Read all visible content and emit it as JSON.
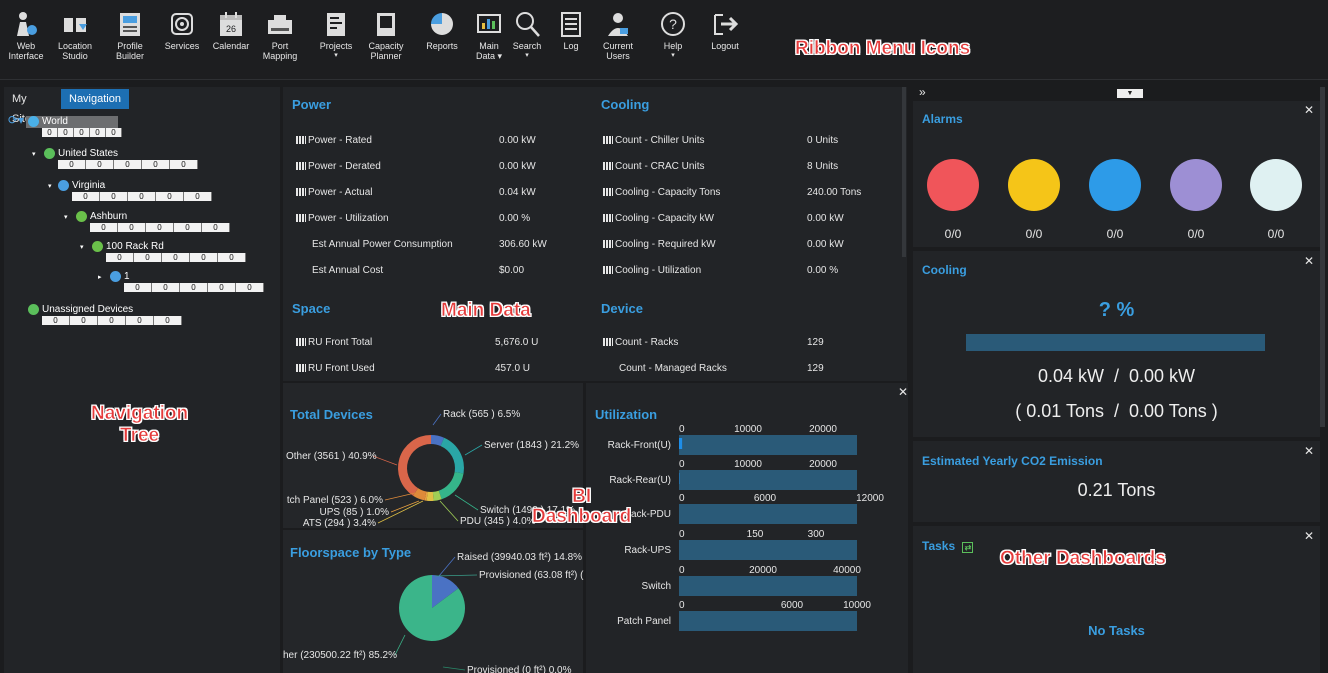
{
  "ribbon": {
    "items": [
      {
        "label": "Web\nInterface",
        "icon": "web-interface-icon"
      },
      {
        "label": "Location\nStudio",
        "icon": "location-studio-icon"
      },
      {
        "label": "Profile\nBuilder",
        "icon": "profile-builder-icon"
      },
      {
        "label": "Services",
        "icon": "services-icon"
      },
      {
        "label": "Calendar",
        "icon": "calendar-icon",
        "badge": "26"
      },
      {
        "label": "Port\nMapping",
        "icon": "port-mapping-icon"
      },
      {
        "label": "Projects",
        "icon": "projects-icon",
        "dropdown": true
      },
      {
        "label": "Capacity\nPlanner",
        "icon": "capacity-planner-icon"
      },
      {
        "label": "Reports",
        "icon": "reports-icon"
      },
      {
        "label": "Main\nData ▾",
        "icon": "main-data-icon"
      },
      {
        "label": "Search",
        "icon": "search-icon",
        "dropdown": true
      },
      {
        "label": "Log",
        "icon": "log-icon"
      },
      {
        "label": "Current\nUsers",
        "icon": "current-users-icon"
      },
      {
        "label": "Help",
        "icon": "help-icon",
        "dropdown": true
      },
      {
        "label": "Logout",
        "icon": "logout-icon"
      }
    ],
    "annotation": "Ribbon Menu Icons"
  },
  "nav": {
    "tabs": [
      "My Sites",
      "Navigation"
    ],
    "annotation": "Navigation\nTree",
    "tree": [
      {
        "label": "World",
        "counts": [
          "0",
          "0",
          "0",
          "0",
          "0"
        ]
      },
      {
        "label": "United States",
        "counts": [
          "0",
          "0",
          "0",
          "0",
          "0"
        ]
      },
      {
        "label": "Virginia",
        "counts": [
          "0",
          "0",
          "0",
          "0",
          "0"
        ]
      },
      {
        "label": "Ashburn",
        "counts": [
          "0",
          "0",
          "0",
          "0",
          "0"
        ]
      },
      {
        "label": "100 Rack Rd",
        "counts": [
          "0",
          "0",
          "0",
          "0",
          "0"
        ]
      },
      {
        "label": "1",
        "counts": [
          "0",
          "0",
          "0",
          "0",
          "0"
        ]
      },
      {
        "label": "Unassigned Devices",
        "counts": [
          "0",
          "0",
          "0",
          "0",
          "0"
        ]
      }
    ]
  },
  "main": {
    "annotation": "Main Data",
    "power": {
      "title": "Power",
      "rows": [
        {
          "label": "Power - Rated",
          "value": "0.00 kW",
          "chart": true
        },
        {
          "label": "Power - Derated",
          "value": "0.00 kW",
          "chart": true
        },
        {
          "label": "Power - Actual",
          "value": "0.04 kW",
          "chart": true
        },
        {
          "label": "Power - Utilization",
          "value": "0.00 %",
          "chart": true
        },
        {
          "label": "Est Annual Power Consumption",
          "value": "306.60 kW",
          "chart": false
        },
        {
          "label": "Est Annual Cost",
          "value": "$0.00",
          "chart": false
        }
      ]
    },
    "cooling": {
      "title": "Cooling",
      "rows": [
        {
          "label": "Count - Chiller Units",
          "value": "0   Units"
        },
        {
          "label": "Count - CRAC Units",
          "value": "8   Units"
        },
        {
          "label": "Cooling - Capacity Tons",
          "value": "240.00 Tons"
        },
        {
          "label": "Cooling - Capacity kW",
          "value": "0.00 kW"
        },
        {
          "label": "Cooling - Required kW",
          "value": "0.00 kW"
        },
        {
          "label": "Cooling - Utilization",
          "value": "0.00 %"
        }
      ]
    },
    "space": {
      "title": "Space",
      "rows": [
        {
          "label": "RU Front Total",
          "value": "5,676.0  U",
          "chart": true
        },
        {
          "label": "RU Front Used",
          "value": "457.0  U",
          "chart": true
        }
      ]
    },
    "device": {
      "title": "Device",
      "rows": [
        {
          "label": "Count - Racks",
          "value": "129",
          "chart": true
        },
        {
          "label": "Count - Managed Racks",
          "value": "129",
          "chart": false
        }
      ]
    }
  },
  "bi": {
    "annotation_line1": "BI",
    "annotation_line2": "Dashboard",
    "total_devices": {
      "title": "Total Devices",
      "slices": [
        {
          "label": "Rack  (565 ) 6.5%",
          "value": 6.5,
          "color": "#4a72c4"
        },
        {
          "label": "Server  (1843 ) 21.2%",
          "value": 21.2,
          "color": "#2aa6a6"
        },
        {
          "label": "Switch  (1492 ) 17.1%",
          "value": 17.1,
          "color": "#35b58a"
        },
        {
          "label": "PDU  (345 ) 4.0%",
          "value": 4.0,
          "color": "#9fcf56"
        },
        {
          "label": "ATS  (294 ) 3.4%",
          "value": 3.4,
          "color": "#e0c045"
        },
        {
          "label": "UPS  (85 ) 1.0%",
          "value": 1.0,
          "color": "#e8a040"
        },
        {
          "label": "tch Panel  (523 ) 6.0%",
          "value": 6.0,
          "color": "#de8a3a"
        },
        {
          "label": "Other  (3561 ) 40.9%",
          "value": 40.9,
          "color": "#d9664a"
        }
      ]
    },
    "floorspace": {
      "title": "Floorspace by Type",
      "slices": [
        {
          "label": "Raised  (39940.03 ft²) 14.8%",
          "value": 14.8,
          "color": "#4a72c4"
        },
        {
          "label": "Provisioned  (63.08 ft²) (",
          "value": 0.02,
          "color": "#3a9e8a"
        },
        {
          "label": "her  (230500.22 ft²) 85.2%",
          "value": 85.2,
          "color": "#3bb58a"
        },
        {
          "label": "Provisioned  (0 ft²) 0.0%",
          "value": 0.0,
          "color": "#2a8a6a"
        }
      ]
    },
    "utilization": {
      "title": "Utilization",
      "rows": [
        {
          "label": "Rack-Front(U)",
          "ticks": [
            "0",
            "10000",
            "20000"
          ],
          "value": 457,
          "max": 26000
        },
        {
          "label": "Rack-Rear(U)",
          "ticks": [
            "0",
            "10000",
            "20000"
          ],
          "value": 60,
          "max": 26000
        },
        {
          "label": "Rack-PDU",
          "ticks": [
            "0",
            "6000",
            "12000"
          ],
          "value": 0,
          "max": 13000
        },
        {
          "label": "Rack-UPS",
          "ticks": [
            "0",
            "150",
            "300"
          ],
          "value": 0,
          "max": 350
        },
        {
          "label": "Switch",
          "ticks": [
            "0",
            "20000",
            "40000"
          ],
          "value": 0,
          "max": 48000
        },
        {
          "label": "Patch Panel",
          "ticks": [
            "0",
            "6000",
            "10000"
          ],
          "value": 0,
          "max": 12000
        }
      ]
    }
  },
  "right": {
    "alarms": {
      "title": "Alarms",
      "items": [
        {
          "color": "#f0555a",
          "value": "0/0"
        },
        {
          "color": "#f5c518",
          "value": "0/0"
        },
        {
          "color": "#2d9be8",
          "value": "0/0"
        },
        {
          "color": "#9d8fd4",
          "value": "0/0"
        },
        {
          "color": "#dff1f2",
          "value": "0/0"
        }
      ]
    },
    "cooling": {
      "title": "Cooling",
      "percent": "? %",
      "kw": "0.04 kW  /  0.00 kW",
      "tons": "( 0.01 Tons  /  0.00 Tons )"
    },
    "co2": {
      "title": "Estimated Yearly CO2 Emission",
      "value": "0.21 Tons"
    },
    "tasks": {
      "title": "Tasks",
      "empty": "No Tasks",
      "annotation": "Other Dashboards"
    },
    "collapse": "»"
  }
}
